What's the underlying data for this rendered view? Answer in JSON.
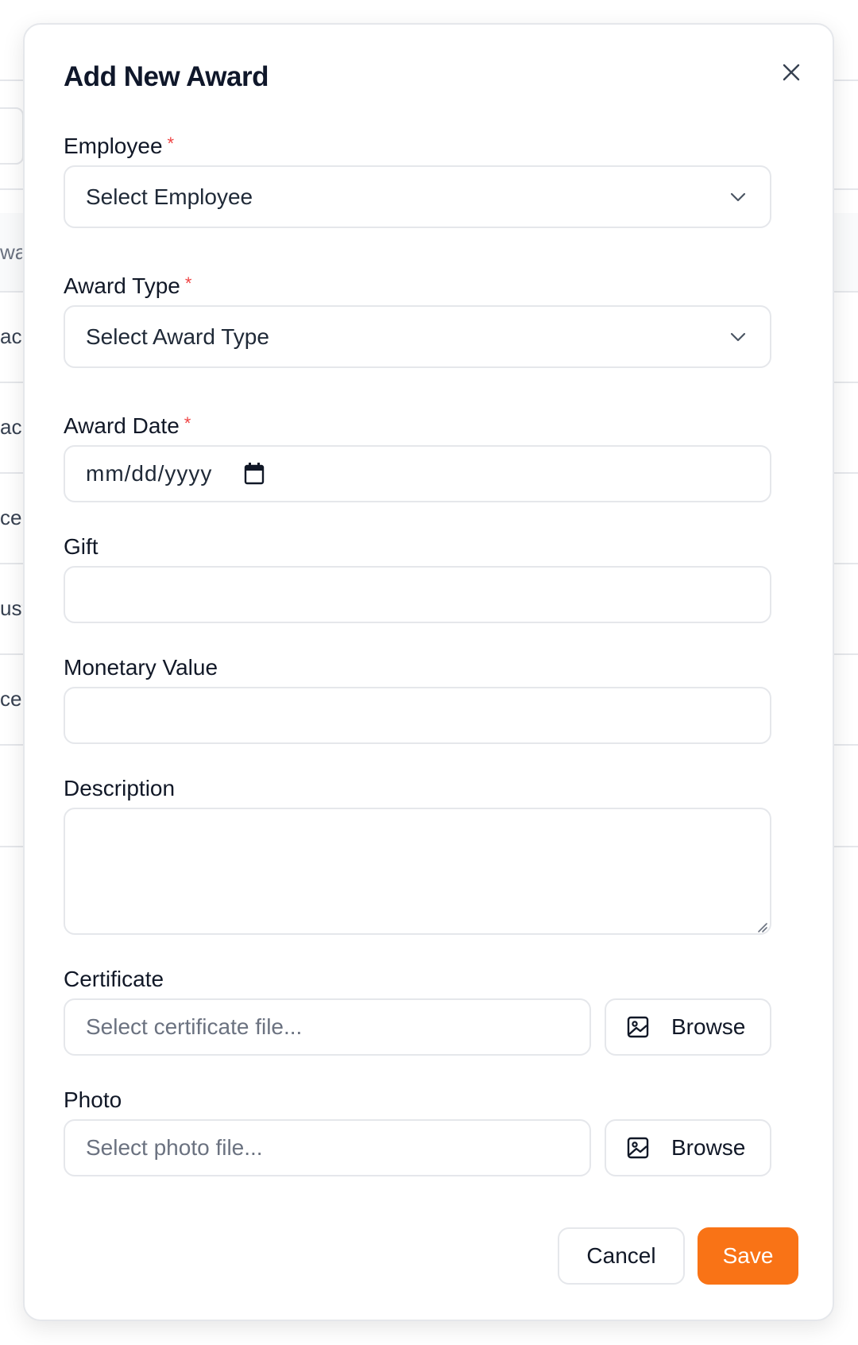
{
  "background": {
    "fragments": [
      "wa",
      "ac",
      "ac",
      "ce",
      "ust",
      "ce"
    ]
  },
  "modal": {
    "title": "Add New Award",
    "close_icon": "close-icon",
    "required_marker": "*",
    "fields": {
      "employee": {
        "label": "Employee",
        "placeholder": "Select Employee",
        "icon": "chevron-down-icon"
      },
      "award_type": {
        "label": "Award Type",
        "placeholder": "Select Award Type",
        "icon": "chevron-down-icon"
      },
      "award_date": {
        "label": "Award Date",
        "placeholder": "mm/dd/yyyy",
        "icon": "calendar-icon"
      },
      "gift": {
        "label": "Gift",
        "value": ""
      },
      "monetary_value": {
        "label": "Monetary Value",
        "value": ""
      },
      "description": {
        "label": "Description",
        "value": ""
      },
      "certificate": {
        "label": "Certificate",
        "placeholder": "Select certificate file...",
        "browse_label": "Browse",
        "icon": "image-icon"
      },
      "photo": {
        "label": "Photo",
        "placeholder": "Select photo file...",
        "browse_label": "Browse",
        "icon": "image-icon"
      }
    },
    "actions": {
      "cancel_label": "Cancel",
      "save_label": "Save"
    }
  },
  "colors": {
    "accent": "#f97316",
    "required": "#ef4444",
    "border": "#e5e7eb"
  }
}
